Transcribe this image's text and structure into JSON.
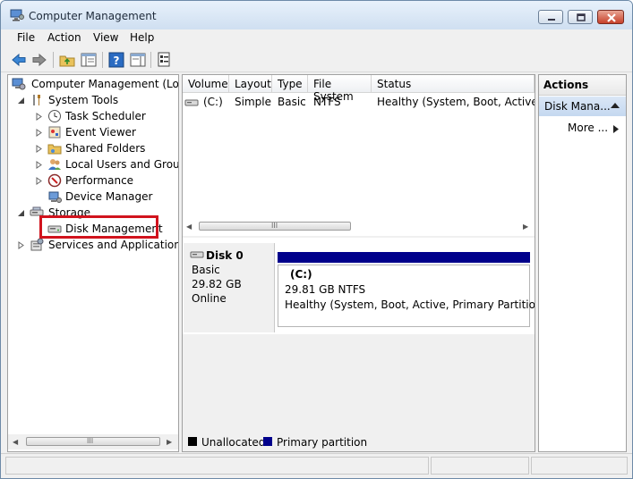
{
  "window": {
    "title": "Computer Management"
  },
  "menu": [
    "File",
    "Action",
    "View",
    "Help"
  ],
  "tree": {
    "root": "Computer Management (Local",
    "system_tools": "System Tools",
    "task_scheduler": "Task Scheduler",
    "event_viewer": "Event Viewer",
    "shared_folders": "Shared Folders",
    "local_users_groups": "Local Users and Groups",
    "performance": "Performance",
    "device_manager": "Device Manager",
    "storage": "Storage",
    "disk_management": "Disk Management",
    "services_apps": "Services and Applications"
  },
  "volume_list": {
    "columns": [
      "Volume",
      "Layout",
      "Type",
      "File System",
      "Status"
    ],
    "rows": [
      {
        "volume": "(C:)",
        "layout": "Simple",
        "type": "Basic",
        "file_system": "NTFS",
        "status": "Healthy (System, Boot, Active, Pr"
      }
    ]
  },
  "scroll": {
    "grip": "III",
    "left": "◀",
    "right": "▶"
  },
  "disk": {
    "name": "Disk 0",
    "type": "Basic",
    "size": "29.82 GB",
    "state": "Online",
    "partition": {
      "label": "(C:)",
      "size_fs": "29.81 GB NTFS",
      "status": "Healthy (System, Boot, Active, Primary Partition)"
    }
  },
  "legend": {
    "unallocated": "Unallocated",
    "primary": "Primary partition"
  },
  "legend_colors": {
    "unallocated": "#000000",
    "primary": "#00008b"
  },
  "actions": {
    "header": "Actions",
    "section": "Disk Mana...",
    "more": "More ..."
  }
}
